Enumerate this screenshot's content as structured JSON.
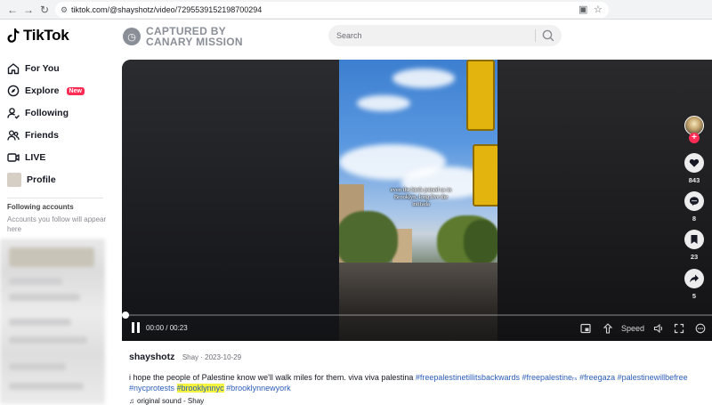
{
  "browser": {
    "url": "tiktok.com/@shayshotz/video/7295539152198700294"
  },
  "brand": {
    "name": "TikTok"
  },
  "watermark": {
    "line1": "CAPTURED BY",
    "line2": "CANARY MISSION"
  },
  "search": {
    "placeholder": "Search"
  },
  "sidebar": {
    "items": [
      {
        "label": "For You",
        "icon": "home-icon"
      },
      {
        "label": "Explore",
        "icon": "compass-icon",
        "badge": "New"
      },
      {
        "label": "Following",
        "icon": "user-follow-icon"
      },
      {
        "label": "Friends",
        "icon": "friends-icon"
      },
      {
        "label": "LIVE",
        "icon": "live-icon"
      },
      {
        "label": "Profile",
        "icon": "avatar"
      }
    ],
    "following_heading": "Following accounts",
    "following_hint": "Accounts you follow will appear here"
  },
  "video": {
    "caption": "even the birds joined us in Brooklyn, long live the intifada",
    "time": "00:00 / 00:23",
    "progress": 0,
    "speed_label": "Speed"
  },
  "actions": {
    "likes": "843",
    "comments": "8",
    "saves": "23",
    "shares": "5"
  },
  "post": {
    "author": "shayshotz",
    "author_sub": "Shay · 2023-10-29",
    "text": "i hope the people of Palestine know we'll walk miles for them. viva viva palestina",
    "hashtags": [
      {
        "text": "#freepalestinetillitsbackwards",
        "highlight": false
      },
      {
        "text": "#freepalestineᵣₛ",
        "highlight": false
      },
      {
        "text": "#freegaza",
        "highlight": false
      },
      {
        "text": "#palestinewillbefree",
        "highlight": false
      },
      {
        "text": "#nycprotests",
        "highlight": false
      },
      {
        "text": "#brooklynnyc",
        "highlight": true
      },
      {
        "text": "#brooklynnewyork",
        "highlight": false
      }
    ],
    "sound": "original sound - Shay"
  },
  "colors": {
    "accent": "#fe2c55",
    "hashtag": "#2b5db9",
    "highlight": "#f5f33d"
  }
}
